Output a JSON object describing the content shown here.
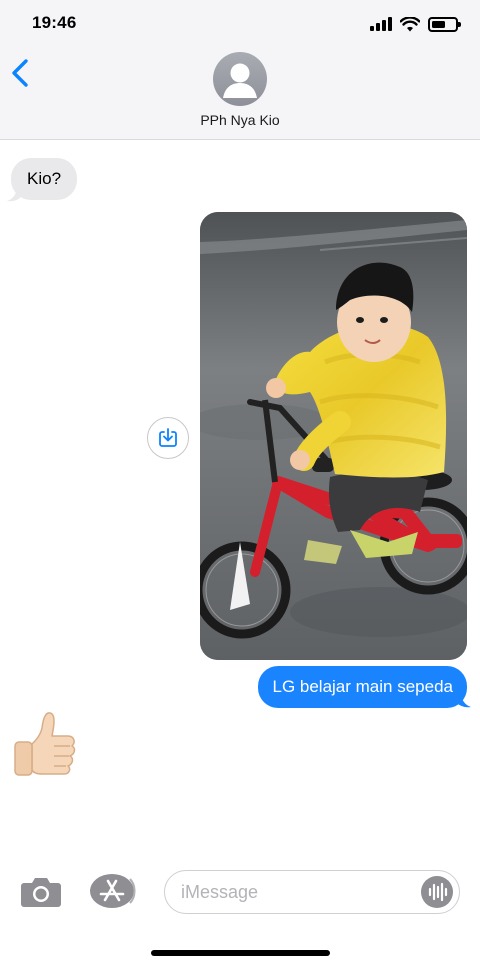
{
  "status_bar": {
    "time": "19:46",
    "icons": [
      "cellular-signal-icon",
      "wifi-icon",
      "battery-icon"
    ],
    "battery_level": 0.6
  },
  "header": {
    "back_icon": "chevron-left-icon",
    "avatar_icon": "person-silhouette-icon",
    "contact_name": "PPh Nya Kio"
  },
  "messages": [
    {
      "direction": "incoming",
      "type": "text",
      "text": "Kio?"
    },
    {
      "direction": "outgoing",
      "type": "photo",
      "subject": "child-on-red-bicycle",
      "save_icon": "download-save-icon"
    },
    {
      "direction": "outgoing",
      "type": "text",
      "text": "LG belajar main sepeda"
    },
    {
      "direction": "incoming",
      "type": "emoji",
      "text": "👍🏻"
    }
  ],
  "compose": {
    "camera_icon": "camera-icon",
    "apps_icon": "app-store-icon",
    "placeholder": "iMessage",
    "audio_icon": "audio-waveform-icon"
  },
  "colors": {
    "outgoing_bubble": "#1a84ff",
    "incoming_bubble": "#e9e9eb",
    "accent": "#0a84ff",
    "header_bg": "#f5f5f7"
  }
}
